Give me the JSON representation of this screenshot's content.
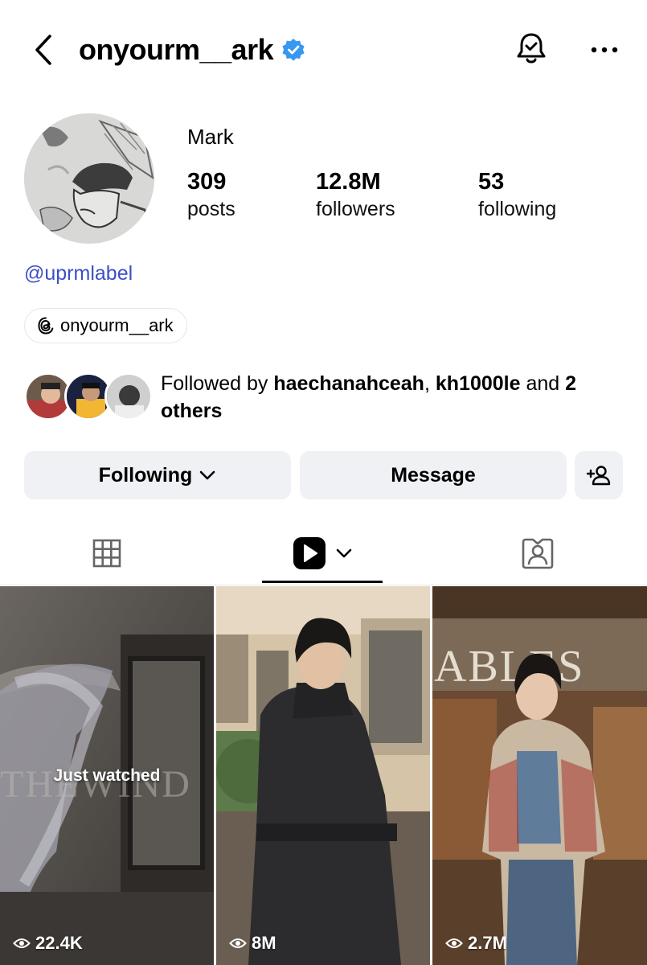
{
  "header": {
    "username": "onyourm__ark"
  },
  "profile": {
    "display_name": "Mark",
    "stats": [
      {
        "value": "309",
        "label": "posts"
      },
      {
        "value": "12.8M",
        "label": "followers"
      },
      {
        "value": "53",
        "label": "following"
      }
    ],
    "mention": "@uprmlabel",
    "threads_handle": "onyourm__ark"
  },
  "followed_by": {
    "prefix": "Followed by ",
    "user1": "haechanahceah",
    "sep": ", ",
    "user2": "kh1000le",
    "and": " and ",
    "others": "2 others"
  },
  "actions": {
    "following_label": "Following",
    "message_label": "Message"
  },
  "tabs": {
    "active": "reels"
  },
  "reels": [
    {
      "views": "22.4K",
      "overlay": "Just watched"
    },
    {
      "views": "8M"
    },
    {
      "views": "2.7M"
    }
  ],
  "colors": {
    "accent_link": "#3d4fc5",
    "verified_blue": "#3897f0",
    "button_bg": "#eff1f4"
  }
}
